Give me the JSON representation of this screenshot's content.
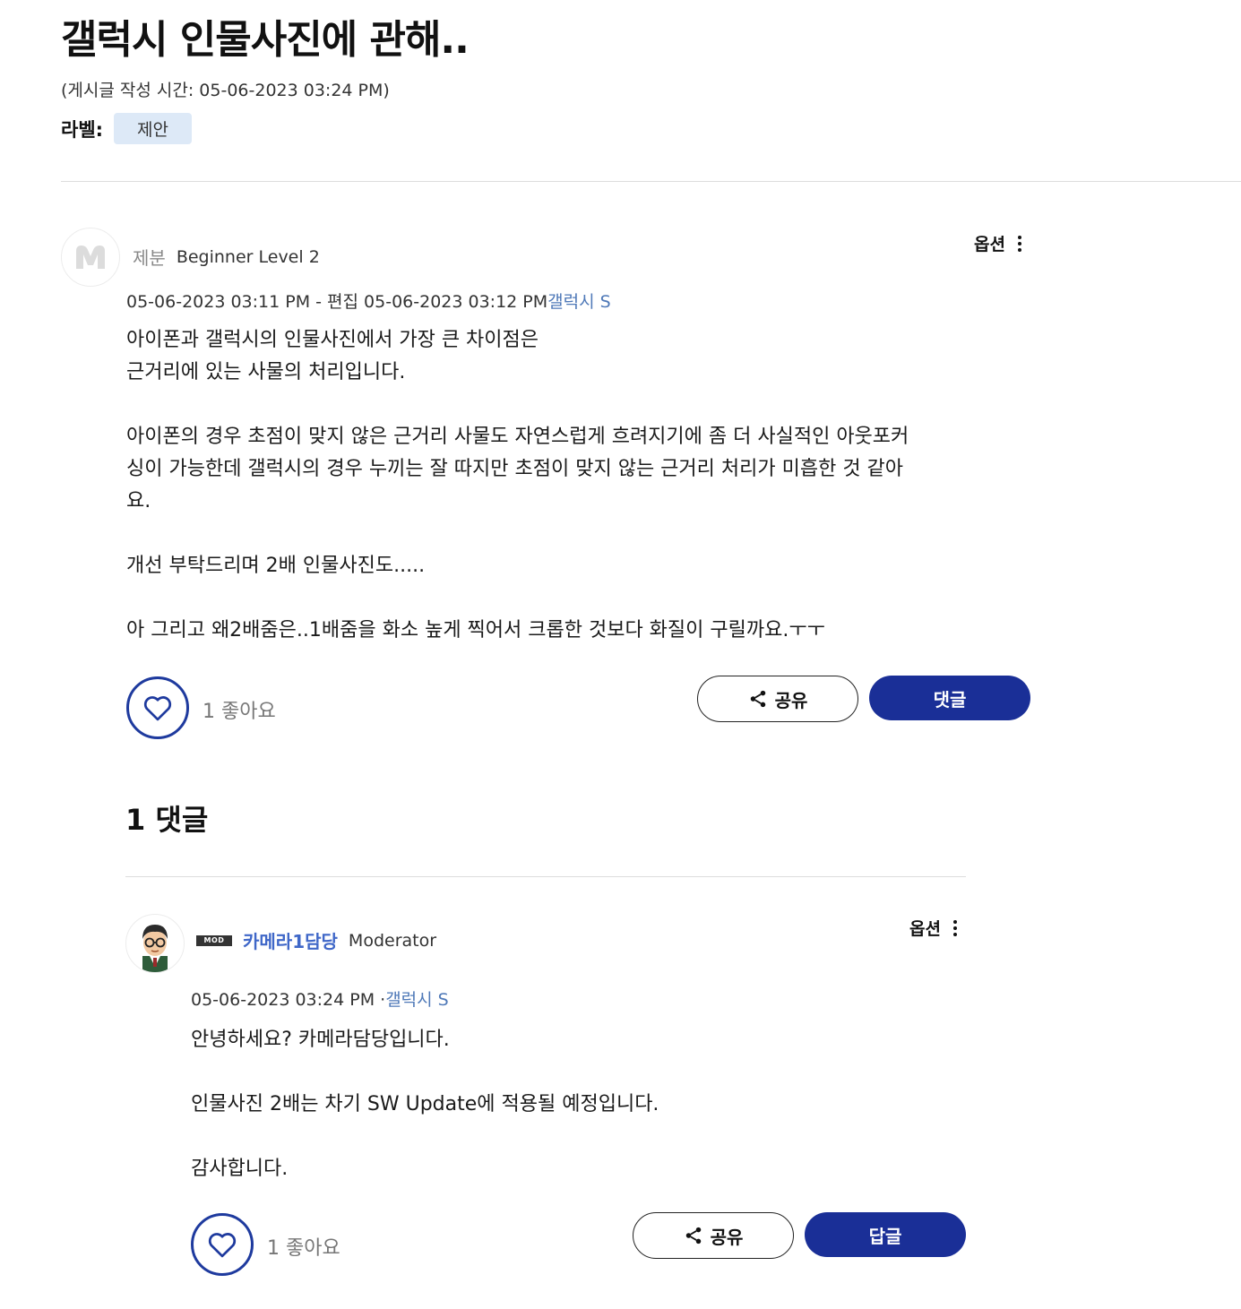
{
  "post": {
    "title": "갤럭시 인물사진에 관해..",
    "post_time": "(게시글 작성 시간: 05-06-2023 03:24 PM)",
    "labels_key": "라벨:",
    "label": "제안"
  },
  "main_message": {
    "author": "제분",
    "rank": "Beginner Level 2",
    "options_label": "옵션",
    "date": "05-06-2023 03:11 PM - 편집 05-06-2023 03:12 PM",
    "device": "갤럭시 S",
    "body": [
      "아이폰과 갤럭시의 인물사진에서 가장 큰 차이점은",
      "근거리에 있는 사물의 처리입니다.",
      "",
      "아이폰의 경우 초점이 맞지 않은 근거리 사물도 자연스럽게 흐려지기에 좀 더 사실적인 아웃포커",
      "싱이 가능한데 갤럭시의 경우 누끼는 잘 따지만 초점이 맞지 않는 근거리 처리가 미흡한 것 같아",
      "요.",
      "",
      "개선 부탁드리며 2배 인물사진도.....",
      "",
      "아 그리고 왜2배줌은..1배줌을 화소 높게 찍어서 크롭한 것보다 화질이 구릴까요.ㅜㅜ"
    ],
    "likes": "1 좋아요",
    "share_label": "공유",
    "reply_label": "댓글"
  },
  "comments_header": "1 댓글",
  "reply": {
    "badge": "MOD",
    "author": "카메라1담당",
    "rank": "Moderator",
    "options_label": "옵션",
    "date": "05-06-2023 03:24 PM",
    "separator": "·",
    "device": "갤럭시 S",
    "body": [
      "안녕하세요? 카메라담당입니다.",
      "",
      "인물사진 2배는 차기 SW Update에 적용될 예정입니다.",
      "",
      "감사합니다."
    ],
    "likes": "1 좋아요",
    "share_label": "공유",
    "reply_label": "답글"
  },
  "colors": {
    "primary_button": "#1a2f97",
    "like_ring": "#1e3a9e",
    "device_link": "#4f79b8",
    "mod_name": "#3f67c8",
    "label_chip": "#dde9f7"
  }
}
